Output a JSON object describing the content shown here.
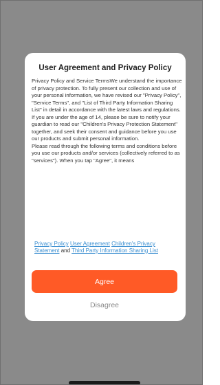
{
  "colors": {
    "overlay": "#8a8a8a",
    "dialog_background": "#ffffff",
    "accent": "#ff5a26",
    "link": "#3b8fd1",
    "disagree_text": "#888888"
  },
  "dialog": {
    "title": "User Agreement and Privacy Policy",
    "body": "Privacy Policy and Service TermsWe understand the importance of privacy protection. To fully present our collection and use of your personal information, we have revised our \"Privacy Policy\", \"Service Terms\", and \"List of Third Party Information Sharing List\" in detail in accordance with the latest laws and regulations.\nIf you are under the age of 14, please be sure to notify your guardian to read our \"Children's Privacy Protection Statement\" together, and seek their consent and guidance before you use our products and submit personal information.\nPlease read through the following terms and conditions before you use our products and/or services (collectively referred to as \"services\"). When you tap \"Agree\", it means",
    "links": {
      "privacy_policy": "Privacy Policy",
      "user_agreement": "User Agreement",
      "childrens_privacy": "Children's Privacy Statement",
      "and_text": "and",
      "third_party": "Third Party Information Sharing List"
    },
    "agree_label": "Agree",
    "disagree_label": "Disagree"
  }
}
